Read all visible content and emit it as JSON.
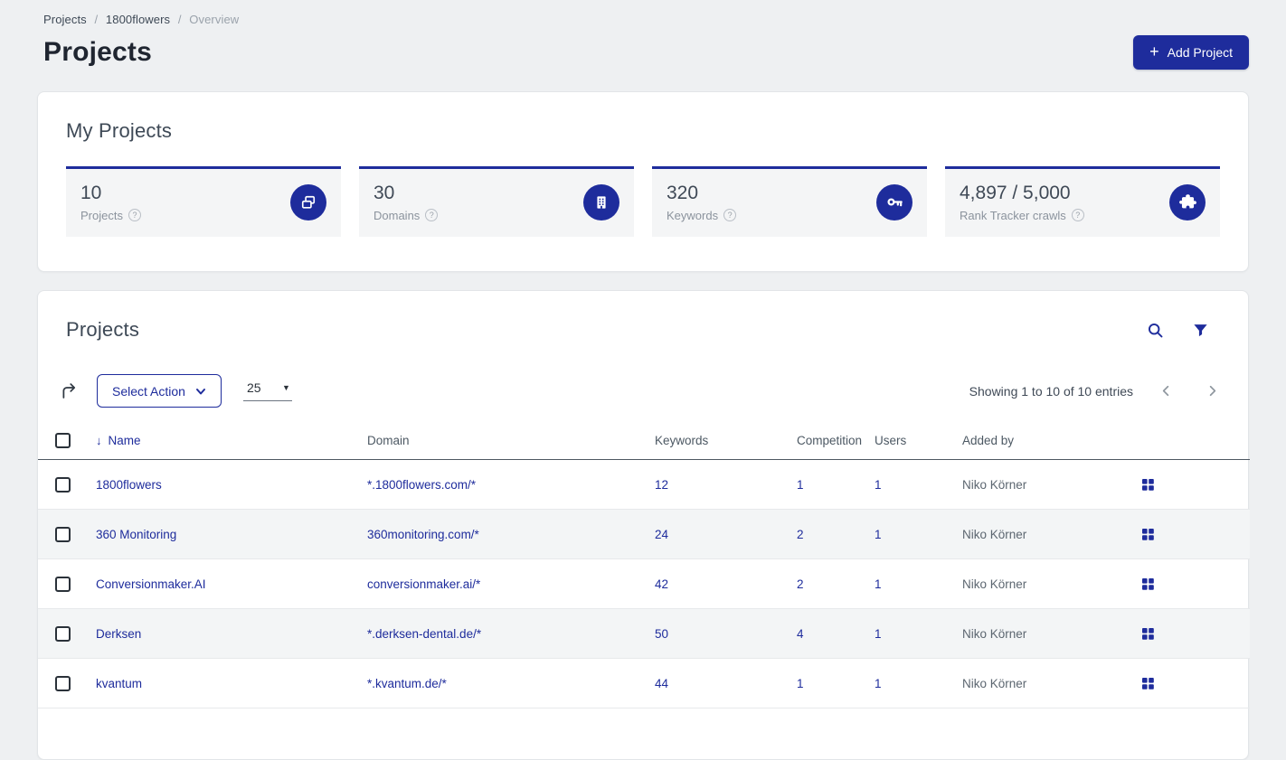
{
  "colors": {
    "brand": "#1e2c9c",
    "page_background": "#eef0f2",
    "stat_card_background": "#f4f5f6"
  },
  "breadcrumb": {
    "separator": "/",
    "items": [
      {
        "label": "Projects"
      },
      {
        "label": "1800flowers"
      },
      {
        "label": "Overview"
      }
    ]
  },
  "header": {
    "title": "Projects",
    "add_project_label": "Add Project",
    "add_project_icon": "plus-icon"
  },
  "my_projects": {
    "title": "My Projects",
    "cards": [
      {
        "value": "10",
        "label": "Projects",
        "icon": "screens-icon"
      },
      {
        "value": "30",
        "label": "Domains",
        "icon": "building-icon"
      },
      {
        "value": "320",
        "label": "Keywords",
        "icon": "key-icon"
      },
      {
        "value": "4,897 / 5,000",
        "label": "Rank Tracker crawls",
        "icon": "puzzle-icon"
      }
    ]
  },
  "projects_panel": {
    "title": "Projects",
    "icons": {
      "search": "search-icon",
      "filter": "filter-icon"
    },
    "toolbar": {
      "export_icon": "export-arrow-icon",
      "select_action_label": "Select Action",
      "page_size_value": "25",
      "showing_text": "Showing 1 to 10 of 10 entries"
    },
    "columns": {
      "name": "Name",
      "domain": "Domain",
      "keywords": "Keywords",
      "competition": "Competition",
      "users": "Users",
      "added_by": "Added by"
    },
    "sort_indicator": "↓",
    "rows": [
      {
        "name": "1800flowers",
        "domain": "*.1800flowers.com/*",
        "keywords": "12",
        "competition": "1",
        "users": "1",
        "added_by": "Niko Körner"
      },
      {
        "name": "360 Monitoring",
        "domain": "360monitoring.com/*",
        "keywords": "24",
        "competition": "2",
        "users": "1",
        "added_by": "Niko Körner"
      },
      {
        "name": "Conversionmaker.AI",
        "domain": "conversionmaker.ai/*",
        "keywords": "42",
        "competition": "2",
        "users": "1",
        "added_by": "Niko Körner"
      },
      {
        "name": "Derksen",
        "domain": "*.derksen-dental.de/*",
        "keywords": "50",
        "competition": "4",
        "users": "1",
        "added_by": "Niko Körner"
      },
      {
        "name": "kvantum",
        "domain": "*.kvantum.de/*",
        "keywords": "44",
        "competition": "1",
        "users": "1",
        "added_by": "Niko Körner"
      }
    ]
  }
}
